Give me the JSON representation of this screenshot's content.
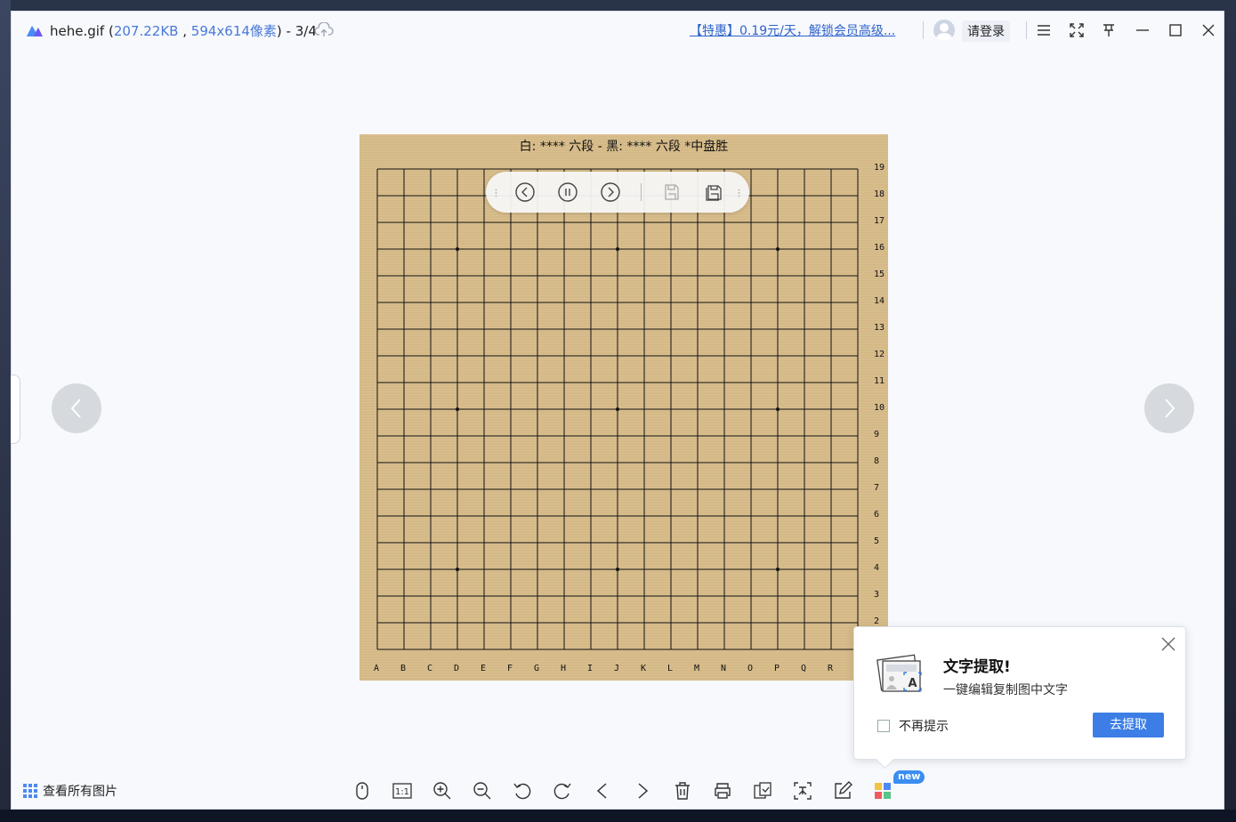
{
  "window": {
    "file_name": "hehe.gif",
    "file_size": "207.22KB",
    "dimensions": "594x614像素",
    "page_counter": "- 3/4",
    "promo": "【特惠】0.19元/天，解锁会员高级...",
    "login": "请登录"
  },
  "board": {
    "title": "白: **** 六段 - 黑: **** 六段  *中盘胜",
    "col_labels": [
      "A",
      "B",
      "C",
      "D",
      "E",
      "F",
      "G",
      "H",
      "I",
      "J",
      "K",
      "L",
      "M",
      "N",
      "O",
      "P",
      "Q",
      "R"
    ],
    "row_labels": [
      "19",
      "18",
      "17",
      "16",
      "15",
      "14",
      "13",
      "12",
      "11",
      "10",
      "9",
      "8",
      "7",
      "6",
      "5",
      "4",
      "3",
      "2"
    ]
  },
  "bottom": {
    "all_pics": "查看所有图片",
    "new_badge": "new"
  },
  "popup": {
    "title": "文字提取!",
    "desc": "一键编辑复制图中文字",
    "dont_show": "不再提示",
    "button": "去提取"
  },
  "colors": {
    "board": "#d7bb88",
    "accent": "#3c7ee5",
    "link": "#2e62c9"
  },
  "icons": [
    "app-logo-icon",
    "cloud-upload-icon",
    "avatar-icon",
    "menu-icon",
    "fullscreen-icon",
    "pin-icon",
    "minimize-icon",
    "maximize-icon",
    "close-icon",
    "prev-image-icon",
    "next-image-icon",
    "grid-icon",
    "mouse-icon",
    "actual-size-icon",
    "zoom-in-icon",
    "zoom-out-icon",
    "rotate-left-icon",
    "rotate-right-icon",
    "previous-icon",
    "next-icon",
    "delete-icon",
    "print-icon",
    "convert-icon",
    "ocr-icon",
    "edit-icon",
    "apps-icon"
  ]
}
